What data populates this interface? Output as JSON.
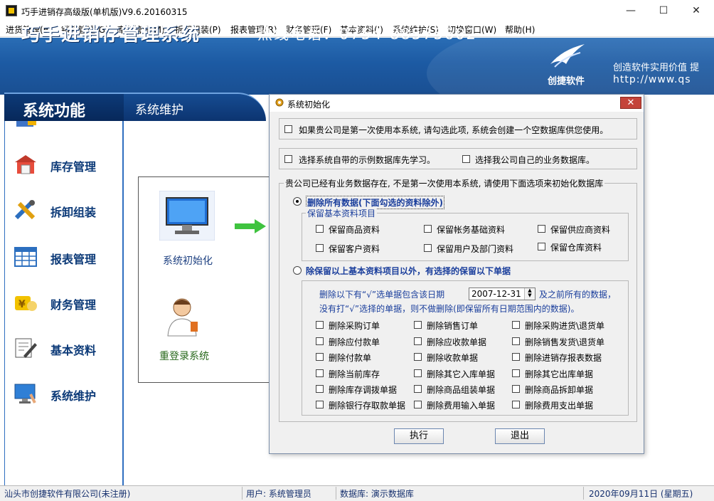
{
  "window": {
    "title": "巧手进销存高级版(单机版)V9.6.20160315",
    "controls": {
      "minimize": "—",
      "maximize": "☐",
      "close": "✕"
    }
  },
  "menu": [
    "进货管理(B)",
    "销售管理(G)",
    "库存管理(M)",
    "拆卸组装(P)",
    "报表管理(R)",
    "财务管理(F)",
    "基本资料(I)",
    "系统维护(S)",
    "切换窗口(W)",
    "帮助(H)"
  ],
  "banner": {
    "title": "巧手进销存管理系统",
    "phone": "热线电话：0754-88575602",
    "logo_text": "创捷软件",
    "slogan": "创造软件实用价值  提",
    "website": "http://www.qs"
  },
  "nav": {
    "left": "系统功能",
    "right": "系统维护"
  },
  "sidebar": {
    "items": [
      {
        "label": "库存管理",
        "icon": "warehouse-icon"
      },
      {
        "label": "拆卸组装",
        "icon": "tools-icon"
      },
      {
        "label": "报表管理",
        "icon": "table-icon"
      },
      {
        "label": "财务管理",
        "icon": "money-icon"
      },
      {
        "label": "基本资料",
        "icon": "edit-icon"
      },
      {
        "label": "系统维护",
        "icon": "monitor-icon"
      }
    ]
  },
  "main": {
    "init_label": "系统初始化",
    "relogin_label": "重登录系统"
  },
  "dialog": {
    "title": "系统初始化",
    "close": "✕",
    "opt_first_use": "如果贵公司是第一次使用本系统, 请勾选此项, 系统会创建一个空数据库供您使用。",
    "opt_sample_db": "选择系统自带的示例数据库先学习。",
    "opt_own_db": "选择我公司自己的业务数据库。",
    "existing_group_title": "贵公司已经有业务数据存在, 不是第一次使用本系统, 请使用下面选项来初始化数据库",
    "radio_delete_all": "删除所有数据(下面勾选的资料除外)",
    "keep_group_title": "保留基本资料项目",
    "keep_items": [
      "保留商品资料",
      "保留帐务基础资料",
      "保留供应商资料",
      "保留客户资料",
      "保留用户及部门资料",
      "保留仓库资料"
    ],
    "radio_keep_except": "除保留以上基本资料项目以外，有选择的保留以下单据",
    "delete_note_1a": "删除以下有“√”选单据包含该日期",
    "date_value": "2007-12-31",
    "delete_note_1b": "及之前所有的数据，",
    "delete_note_2": "没有打“√”选择的单据，则不做删除(即保留所有日期范围内的数据)。",
    "delete_items": [
      "删除采购订单",
      "删除销售订单",
      "删除采购进货\\退货单",
      "删除应付款单",
      "删除应收款单据",
      "删除销售发货\\退货单",
      "删除付款单",
      "删除收款单据",
      "删除进销存报表数据",
      "删除当前库存",
      "删除其它入库单据",
      "删除其它出库单据",
      "删除库存调拨单据",
      "删除商品组装单据",
      "删除商品拆卸单据",
      "删除银行存取款单据",
      "删除费用输入单据",
      "删除费用支出单据"
    ],
    "btn_execute": "执行",
    "btn_exit": "退出"
  },
  "status": {
    "company": "汕头市创捷软件有限公司(未注册)",
    "user": "用户: 系统管理员",
    "database": "数据库: 演示数据库",
    "date": "2020年09月11日 (星期五)"
  },
  "colors": {
    "banner": "#1c5aa3",
    "sidebar_label": "#0c3a78",
    "dialog_blue": "#1a3e9c"
  }
}
